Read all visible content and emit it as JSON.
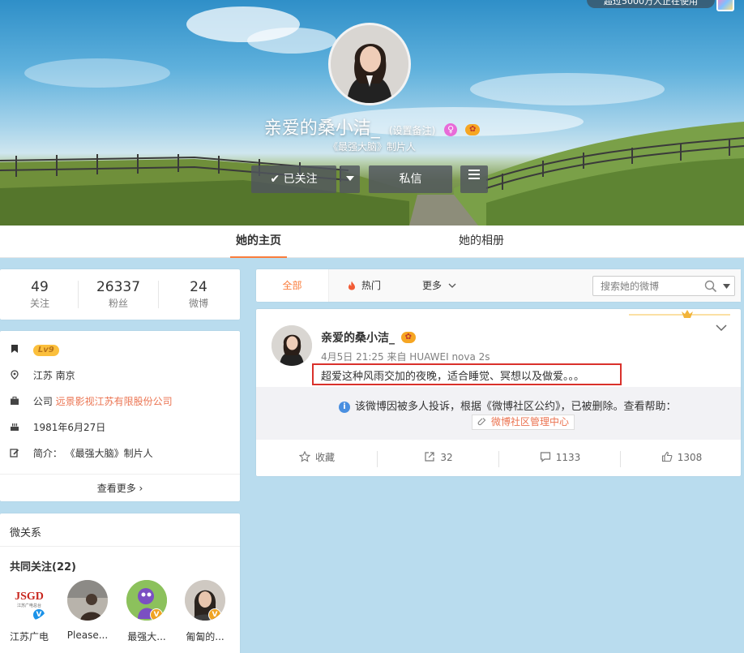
{
  "header": {
    "top_banner": "超过5000万人正在使用",
    "name": "亲爱的桑小洁_",
    "remark": "(设置备注)",
    "pink_badge": "♀",
    "vip_badge": "✿",
    "description": "《最强大脑》制片人",
    "follow_button": "✔ 已关注",
    "message_button": "私信"
  },
  "nav": {
    "home": "她的主页",
    "album": "她的相册"
  },
  "stats": [
    {
      "num": "49",
      "label": "关注"
    },
    {
      "num": "26337",
      "label": "粉丝"
    },
    {
      "num": "24",
      "label": "微博"
    }
  ],
  "info": {
    "level": "Lv9",
    "location": "江苏 南京",
    "company_prefix": "公司",
    "company": "远景影视江苏有限股份公司",
    "birthday": "1981年6月27日",
    "bio_prefix": "简介：",
    "bio": "《最强大脑》制片人",
    "more": "查看更多 ›"
  },
  "relations": {
    "title": "微关系",
    "common_follow": "共同关注(22)",
    "friends": [
      {
        "name": "江苏广电",
        "logo": "JSGD",
        "logo_sub": "江苏广电总台",
        "badge": "V"
      },
      {
        "name": "Please...",
        "badge": ""
      },
      {
        "name": "最强大...",
        "badge": "V"
      },
      {
        "name": "匍匐的...",
        "badge": "V"
      }
    ]
  },
  "filter": {
    "all": "全部",
    "hot": "热门",
    "more": "更多",
    "search_placeholder": "搜索她的微博"
  },
  "post": {
    "author": "亲爱的桑小洁_",
    "vip_badge": "✿",
    "meta": "4月5日 21:25 来自 HUAWEI nova 2s",
    "text": "超爱这种风雨交加的夜晚，适合睡觉、冥想以及做爱。。。",
    "deleted_icon": "i",
    "deleted_notice": "该微博因被多人投诉，根据《微博社区公约》，已被删除。查看帮助：",
    "help_link": "微博社区管理中心",
    "collect": "收藏",
    "forward": "32",
    "comment": "1133",
    "like": "1308"
  },
  "colors": {
    "accent": "#fa7d3c",
    "link": "#eb7350",
    "highlight_border": "#d9312b",
    "page_bg": "#b9dcee"
  }
}
